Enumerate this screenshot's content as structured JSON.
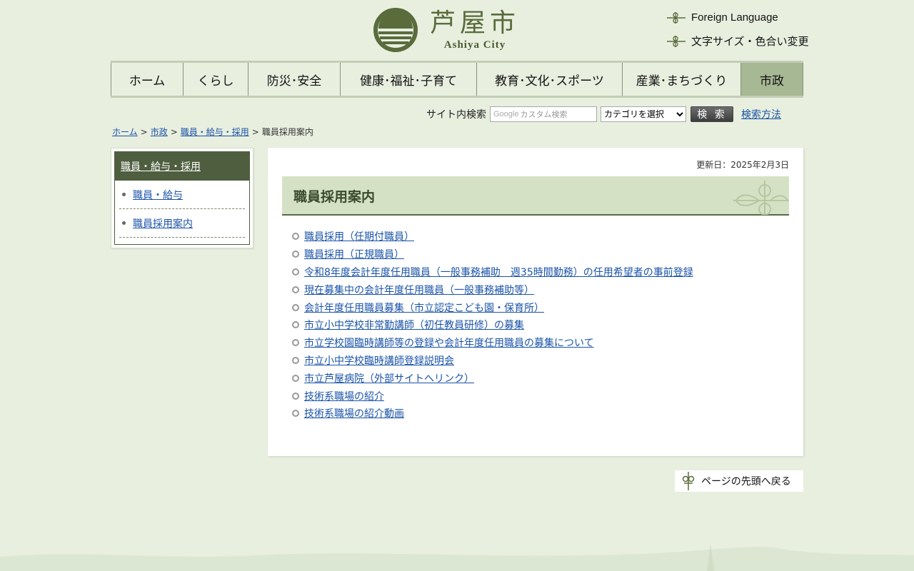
{
  "header": {
    "logo_title": "芦屋市",
    "logo_sub": "Ashiya City",
    "util_foreign": "Foreign Language",
    "util_fontsize": "文字サイズ・色合い変更"
  },
  "nav": {
    "items": [
      {
        "label": "ホーム"
      },
      {
        "label": "くらし"
      },
      {
        "label": "防災･安全"
      },
      {
        "label": "健康･福祉･子育て"
      },
      {
        "label": "教育･文化･スポーツ"
      },
      {
        "label": "産業･まちづくり"
      },
      {
        "label": "市政"
      }
    ],
    "active": "市政"
  },
  "search": {
    "label": "サイト内検索",
    "placeholder": "カスタム検索",
    "google_mark": "Google",
    "category_selected": "カテゴリを選択",
    "button": "検 索",
    "help_link": "検索方法"
  },
  "breadcrumb": {
    "items": [
      "ホーム",
      "市政",
      "職員・給与・採用"
    ],
    "current": "職員採用案内",
    "separator": ">"
  },
  "sidenav": {
    "heading": "職員・給与・採用",
    "items": [
      "職員・給与",
      "職員採用案内"
    ]
  },
  "main": {
    "updated": "更新日：2025年2月3日",
    "title": "職員採用案内",
    "links": [
      "職員採用（任期付職員）",
      "職員採用（正規職員）",
      "令和8年度会計年度任用職員（一般事務補助　週35時間勤務）の任用希望者の事前登録",
      "現在募集中の会計年度任用職員（一般事務補助等）",
      "会計年度任用職員募集（市立認定こども園・保育所）",
      "市立小中学校非常勤講師（初任教員研修）の募集",
      "市立学校園臨時講師等の登録や会計年度任用職員の募集について",
      "市立小中学校臨時講師登録説明会",
      "市立芦屋病院（外部サイトへリンク）",
      "技術系職場の紹介",
      "技術系職場の紹介動画"
    ]
  },
  "pagetop": {
    "label": "ページの先頭へ戻る"
  },
  "colors": {
    "background": "#e8efdf",
    "nav_active": "#a7b894",
    "sidenav_head": "#4e5e3f",
    "heading_bg": "#d5e1c4",
    "link": "#1a53a8",
    "logo": "#5a6b3c"
  },
  "icons": {
    "logo_mark": "ashiya-sun-logo-icon",
    "util_ornament": "ornament-icon",
    "link_bullet": "circle-bullet-icon",
    "pagetop_ornament": "ornament-vertical-icon"
  }
}
